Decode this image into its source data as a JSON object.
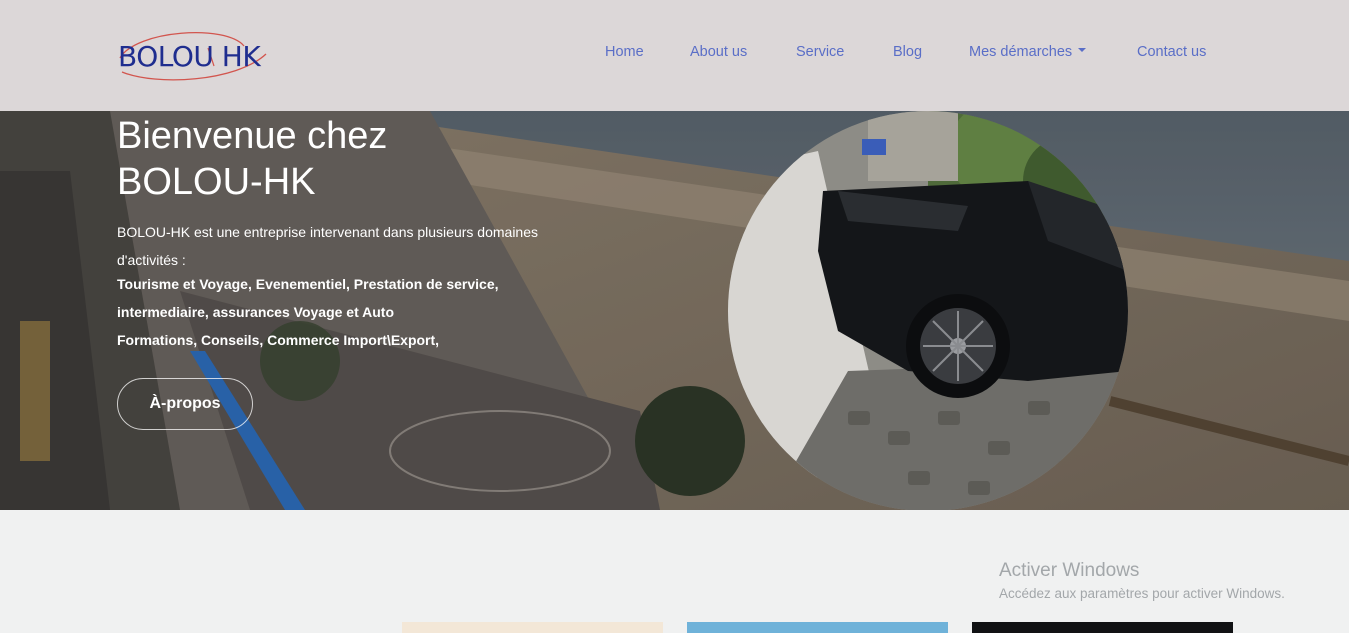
{
  "logo": {
    "text": "BOLOU HK"
  },
  "nav": [
    {
      "label": "Home"
    },
    {
      "label": "About us"
    },
    {
      "label": "Service"
    },
    {
      "label": "Blog"
    },
    {
      "label": "Mes démarches"
    },
    {
      "label": "Contact us"
    }
  ],
  "hero": {
    "title_line1": "Bienvenue chez",
    "title_line2": "BOLOU-HK",
    "intro": "BOLOU-HK est une entreprise intervenant dans plusieurs domaines d'activités :",
    "lines": [
      "Tourisme et Voyage, Evenementiel, Prestation de service,",
      "intermediaire, assurances Voyage et Auto",
      "Formations, Conseils, Commerce Import\\Export,"
    ],
    "button": "À-propos"
  },
  "watermark": {
    "title": "Activer Windows",
    "subtitle": "Accédez aux paramètres pour activer Windows."
  },
  "colors": {
    "header_bg": "#dcd7d8",
    "nav_link": "#5a6ec7",
    "logo": "#1f2d8f",
    "page_bg": "#f0f1f1"
  }
}
